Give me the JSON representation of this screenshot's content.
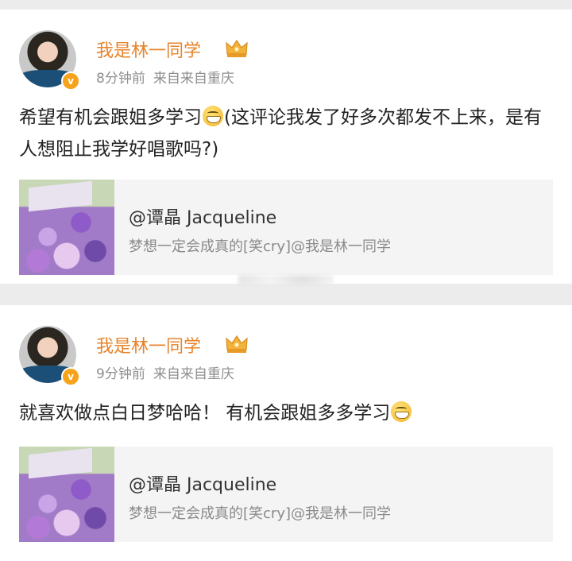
{
  "posts": [
    {
      "username": "我是林一同学",
      "time": "8分钟前",
      "source": "来自来自重庆",
      "text_before_emoji": "希望有机会跟姐多学习",
      "text_after_emoji": "(这评论我发了好多次都发不上来，是有人想阻止我学好唱歌吗?)",
      "quote": {
        "author": "@谭晶 Jacqueline",
        "text": "梦想一定会成真的[笑cry]@我是林一同学"
      }
    },
    {
      "username": "我是林一同学",
      "time": "9分钟前",
      "source": "来自来自重庆",
      "text_before_emoji": "就喜欢做点白日梦哈哈！ 有机会跟姐多多学习",
      "text_after_emoji": "",
      "quote": {
        "author": "@谭晶 Jacqueline",
        "text": "梦想一定会成真的[笑cry]@我是林一同学"
      }
    }
  ],
  "colors": {
    "username": "#e8832a",
    "meta": "#8f8f8f",
    "background": "#ececec",
    "quote_background": "#f4f4f4"
  },
  "icons": {
    "crown": "crown-icon",
    "verified_badge": "verified-badge-icon",
    "emoji": "grin-emoji-icon"
  }
}
